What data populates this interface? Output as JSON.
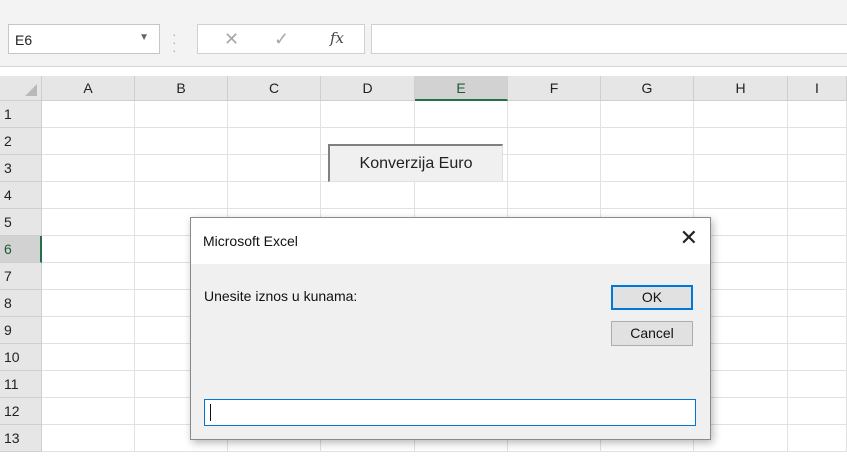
{
  "formula_bar": {
    "name_box": "E6",
    "cancel_icon": "x-icon",
    "enter_icon": "check-icon",
    "function_label": "fx",
    "formula_value": ""
  },
  "grid": {
    "columns": [
      "A",
      "B",
      "C",
      "D",
      "E",
      "F",
      "G",
      "H",
      "I"
    ],
    "rows": [
      "1",
      "2",
      "3",
      "4",
      "5",
      "6",
      "7",
      "8",
      "9",
      "10",
      "11",
      "12",
      "13"
    ],
    "active_column": "E",
    "active_row": "6"
  },
  "sheet_button": {
    "label": "Konverzija Euro"
  },
  "dialog": {
    "title": "Microsoft Excel",
    "prompt": "Unesite iznos u kunama:",
    "ok_label": "OK",
    "cancel_label": "Cancel",
    "input_value": ""
  },
  "colors": {
    "accent": "#217346",
    "focus": "#0078d7"
  }
}
